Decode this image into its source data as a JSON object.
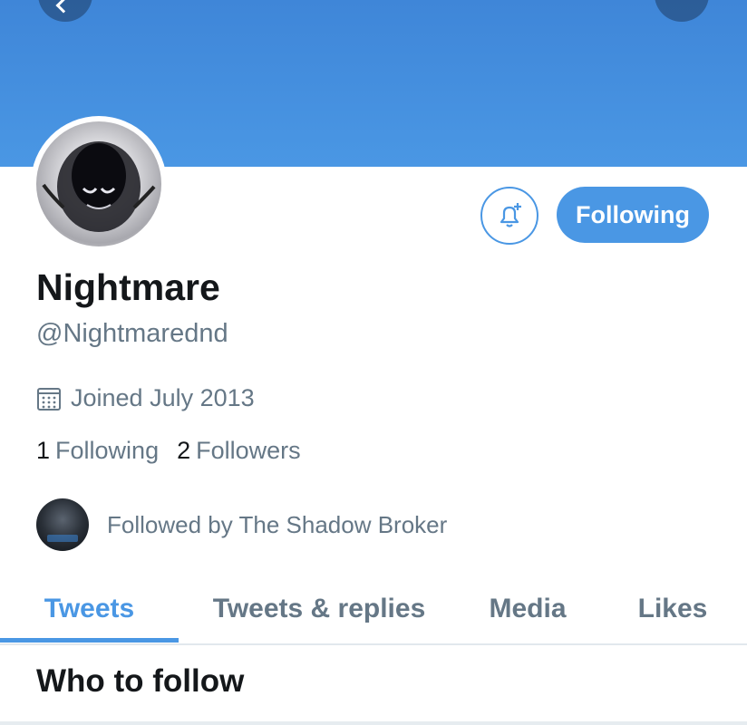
{
  "profile": {
    "display_name": "Nightmare",
    "handle": "@Nightmarednd",
    "joined": "Joined July 2013",
    "following_count": "1",
    "following_label": "Following",
    "followers_count": "2",
    "followers_label": "Followers",
    "followed_by": "Followed by The Shadow Broker"
  },
  "actions": {
    "following_button": "Following"
  },
  "tabs": [
    {
      "label": "Tweets",
      "active": true
    },
    {
      "label": "Tweets & replies",
      "active": false
    },
    {
      "label": "Media",
      "active": false
    },
    {
      "label": "Likes",
      "active": false
    }
  ],
  "section": {
    "title": "Who to follow"
  },
  "colors": {
    "accent": "#4a97e4",
    "banner": "#4a97e4",
    "secondary_text": "#657786"
  },
  "icons": {
    "back": "chevron-left-icon",
    "more": "more-icon",
    "notifications": "bell-plus-icon",
    "calendar": "calendar-icon"
  }
}
